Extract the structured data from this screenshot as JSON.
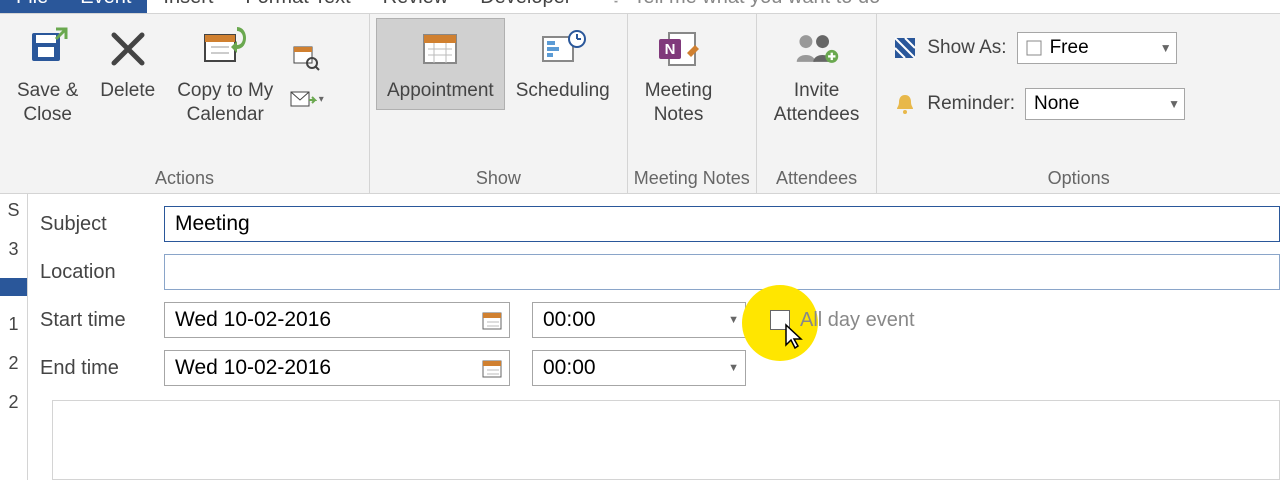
{
  "tabs": {
    "file": "File",
    "event": "Event",
    "insert": "Insert",
    "format_text": "Format Text",
    "review": "Review",
    "developer": "Developer",
    "tell_me": "Tell me what you want to do"
  },
  "ribbon": {
    "actions": {
      "label": "Actions",
      "save_close": "Save &\nClose",
      "delete": "Delete",
      "copy_calendar": "Copy to My\nCalendar"
    },
    "show": {
      "label": "Show",
      "appointment": "Appointment",
      "scheduling": "Scheduling"
    },
    "meeting_notes": {
      "label": "Meeting Notes",
      "meeting_notes": "Meeting\nNotes"
    },
    "attendees": {
      "label": "Attendees",
      "invite": "Invite\nAttendees"
    },
    "options": {
      "label": "Options",
      "show_as": "Show As:",
      "show_as_val": "Free",
      "reminder": "Reminder:",
      "reminder_val": "None"
    }
  },
  "form": {
    "subject_label": "Subject",
    "subject_value": "Meeting ",
    "location_label": "Location",
    "location_value": "",
    "start_label": "Start time",
    "end_label": "End time",
    "start_date": "Wed 10-02-2016",
    "start_time": "00:00",
    "end_date": "Wed 10-02-2016",
    "end_time": "00:00",
    "all_day": "All day event"
  },
  "sidestrip": [
    "S",
    "3",
    "",
    "1",
    "2",
    "2"
  ]
}
